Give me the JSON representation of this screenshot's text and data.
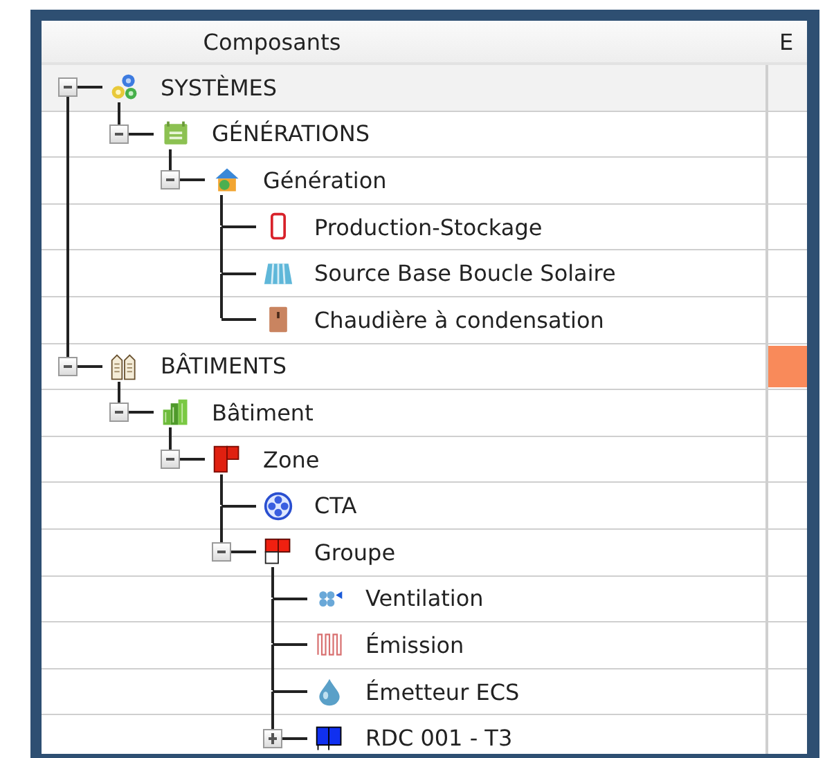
{
  "columns": [
    {
      "label": "Composants"
    },
    {
      "label": "E"
    }
  ],
  "tree": [
    {
      "label": "SYSTÈMES",
      "kind": "gears",
      "expanded": true,
      "selected": true,
      "children": [
        {
          "label": "GÉNÉRATIONS",
          "kind": "calendar",
          "expanded": true,
          "selected": false,
          "children": [
            {
              "label": "Génération",
              "kind": "house",
              "expanded": true,
              "selected": false,
              "children": [
                {
                  "label": "Production-Stockage",
                  "kind": "tank",
                  "selected": false
                },
                {
                  "label": "Source Base Boucle Solaire",
                  "kind": "panel",
                  "selected": false
                },
                {
                  "label": "Chaudière à condensation",
                  "kind": "boiler",
                  "selected": false
                }
              ]
            }
          ]
        }
      ]
    },
    {
      "label": "BÂTIMENTS",
      "kind": "buildings",
      "expanded": true,
      "selected": false,
      "color": "#f98a5a",
      "children": [
        {
          "label": "Bâtiment",
          "kind": "building",
          "expanded": true,
          "selected": false,
          "children": [
            {
              "label": "Zone",
              "kind": "zone",
              "expanded": true,
              "selected": false,
              "children": [
                {
                  "label": "CTA",
                  "kind": "fan",
                  "selected": false
                },
                {
                  "label": "Groupe",
                  "kind": "group",
                  "expanded": true,
                  "selected": false,
                  "children": [
                    {
                      "label": "Ventilation",
                      "kind": "vent",
                      "selected": false
                    },
                    {
                      "label": "Émission",
                      "kind": "radiator",
                      "selected": false
                    },
                    {
                      "label": "Émetteur ECS",
                      "kind": "drop",
                      "selected": false
                    },
                    {
                      "label": "RDC 001 - T3",
                      "kind": "room",
                      "expanded": false,
                      "selected": false
                    }
                  ]
                }
              ]
            }
          ]
        }
      ]
    }
  ]
}
